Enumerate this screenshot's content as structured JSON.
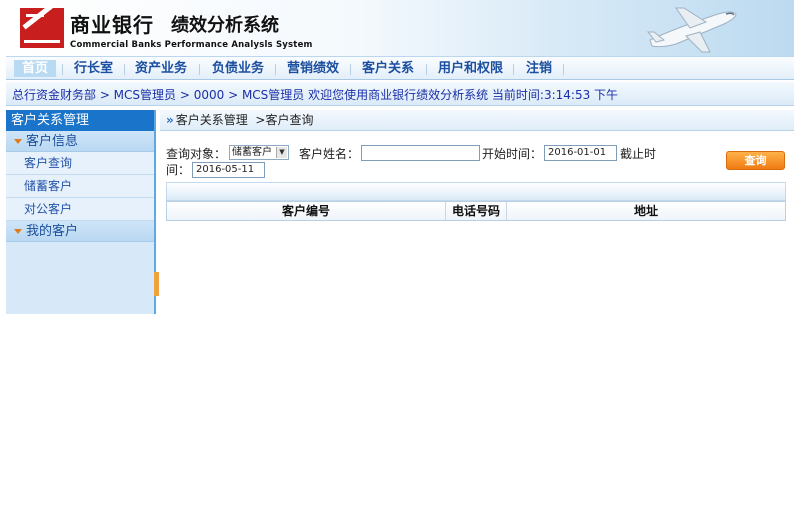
{
  "header": {
    "brand_cn": "商业银行",
    "brand_sub": "绩效分析系统",
    "brand_en": "Commercial Banks  Performance Analysls System"
  },
  "nav": {
    "items": [
      "首页",
      "行长室",
      "资产业务",
      "负债业务",
      "营销绩效",
      "客户关系",
      "用户和权限",
      "注销"
    ],
    "active": "首页"
  },
  "breadcrumb": {
    "text": "总行资金财务部 > MCS管理员 > 0000 > MCS管理员  欢迎您使用商业银行绩效分析系统   当前时间:3:14:53 下午"
  },
  "sidebar": {
    "title": "客户关系管理",
    "groups": [
      {
        "label": "客户信息",
        "items": [
          "客户查询",
          "储蓄客户",
          "对公客户"
        ]
      },
      {
        "label": "我的客户",
        "items": []
      }
    ]
  },
  "main": {
    "crumb_prefix": "»",
    "crumb_1": "客户关系管理",
    "crumb_2": ">客户查询",
    "form": {
      "object_label": "查询对象：",
      "object_value": "储蓄客户",
      "name_label": "客户姓名：",
      "name_value": "",
      "start_label": "开始时间：",
      "start_value": "2016-01-01",
      "end_label_a": "截止时",
      "end_label_b": "间：",
      "end_value": "2016-05-11",
      "query_button": "查询"
    },
    "table": {
      "columns": [
        "客户编号",
        "电话号码",
        "地址"
      ]
    }
  },
  "colors": {
    "accent_blue": "#1a74c9",
    "button_orange": "#f07a12",
    "nav_text": "#1c4fa0"
  },
  "icons": [
    "logo-icon",
    "airplane-icon",
    "expand-arrow-icon",
    "dropdown-caret-icon"
  ]
}
